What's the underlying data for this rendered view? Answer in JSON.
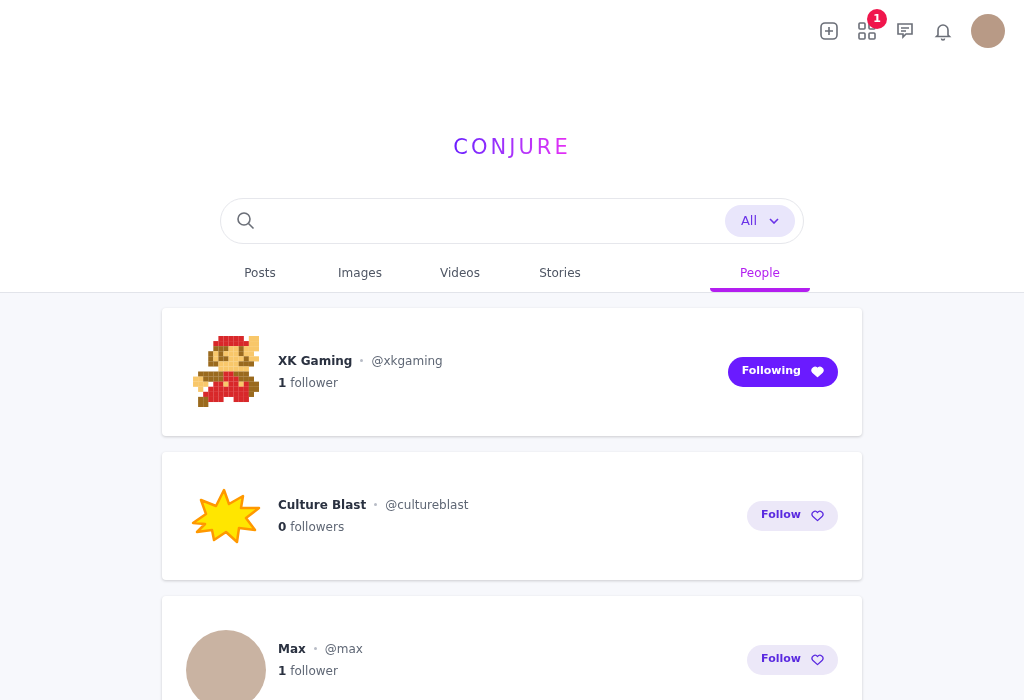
{
  "top_bar": {
    "notification_badge": "1"
  },
  "logo": "CONJURE",
  "search": {
    "filter": "All"
  },
  "tabs": [
    {
      "label": "Posts",
      "selected": false
    },
    {
      "label": "Images",
      "selected": false
    },
    {
      "label": "Videos",
      "selected": false
    },
    {
      "label": "Stories",
      "selected": false
    },
    {
      "label": "People",
      "selected": true
    }
  ],
  "people": [
    {
      "kind": "pixel-art",
      "name": "XK Gaming",
      "handle": "@xkgaming",
      "followers": "**1** follower",
      "following": true,
      "button": "Following"
    },
    {
      "kind": "burst",
      "name": "Culture Blast",
      "handle": "@cultureblast",
      "followers": "**0** followers",
      "following": false,
      "button": "Follow"
    },
    {
      "kind": "photo",
      "name": "Max",
      "handle": "@max",
      "followers": "**1** follower",
      "following": false,
      "button": "Follow"
    }
  ]
}
